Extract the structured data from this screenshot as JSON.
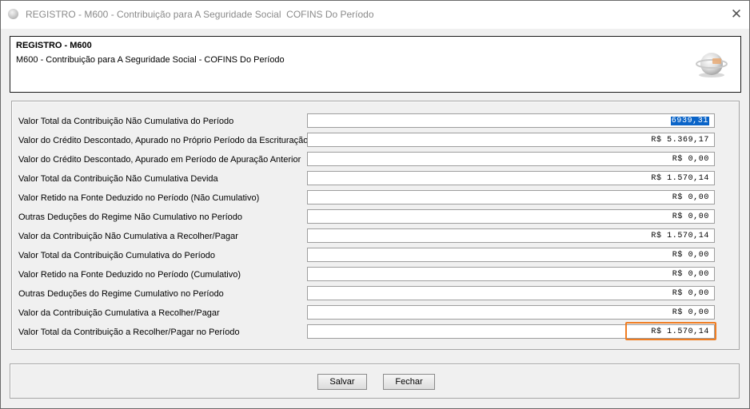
{
  "window": {
    "title": "REGISTRO - M600 - Contribuição para A Seguridade Social  COFINS Do Período",
    "close_icon": "close-icon",
    "app_icon": "app-globe-icon"
  },
  "header": {
    "code": "REGISTRO - M600",
    "description": "M600 - Contribuição para A Seguridade Social - COFINS Do Período",
    "logo_icon": "globe-logo-icon"
  },
  "fields": [
    {
      "label": "Valor Total da Contribuição Não Cumulativa do Período",
      "value": "6939,31"
    },
    {
      "label": "Valor do Crédito Descontado, Apurado no Próprio Período da Escrituração",
      "value": "R$ 5.369,17"
    },
    {
      "label": "Valor do Crédito Descontado, Apurado em Período de Apuração Anterior",
      "value": "R$ 0,00"
    },
    {
      "label": "Valor Total da Contribuição Não Cumulativa Devida",
      "value": "R$ 1.570,14"
    },
    {
      "label": "Valor Retido na Fonte Deduzido no Período (Não Cumulativo)",
      "value": "R$ 0,00"
    },
    {
      "label": "Outras Deduções do Regime Não Cumulativo no Período",
      "value": "R$ 0,00"
    },
    {
      "label": "Valor da Contribuição Não Cumulativa a Recolher/Pagar",
      "value": "R$ 1.570,14"
    },
    {
      "label": "Valor Total da Contribuição Cumulativa do Período",
      "value": "R$ 0,00"
    },
    {
      "label": "Valor Retido na Fonte Deduzido no Período (Cumulativo)",
      "value": "R$ 0,00"
    },
    {
      "label": "Outras Deduções do Regime Cumulativo no Período",
      "value": "R$ 0,00"
    },
    {
      "label": "Valor da Contribuição Cumulativa a Recolher/Pagar",
      "value": "R$ 0,00"
    },
    {
      "label": "Valor Total da Contribuição a Recolher/Pagar no Período",
      "value": "R$ 1.570,14"
    }
  ],
  "buttons": {
    "save": "Salvar",
    "close": "Fechar"
  },
  "colors": {
    "highlight": "#f07d22",
    "selection": "#0a64c8"
  }
}
